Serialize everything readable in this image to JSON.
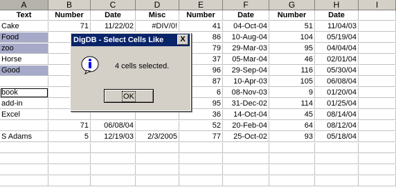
{
  "columns": [
    "A",
    "B",
    "C",
    "D",
    "E",
    "F",
    "G",
    "H",
    "I"
  ],
  "headers": [
    "Text",
    "Number",
    "Date",
    "Misc",
    "Number",
    "Date",
    "Number",
    "Date",
    ""
  ],
  "rows": [
    [
      "Cake",
      "71",
      "11/22/02",
      "#DIV/0!",
      "41",
      "04-Oct-04",
      "51",
      "11/04/03",
      ""
    ],
    [
      "Food",
      "",
      "",
      "",
      "86",
      "10-Aug-04",
      "104",
      "05/19/04",
      ""
    ],
    [
      "zoo",
      "",
      "",
      "",
      "79",
      "29-Mar-03",
      "95",
      "04/04/04",
      ""
    ],
    [
      "Horse",
      "",
      "",
      "",
      "37",
      "05-Mar-04",
      "46",
      "02/01/04",
      ""
    ],
    [
      "Good",
      "",
      "",
      "",
      "96",
      "29-Sep-04",
      "116",
      "05/30/04",
      ""
    ],
    [
      "",
      "",
      "",
      "",
      "87",
      "10-Apr-03",
      "105",
      "06/08/04",
      ""
    ],
    [
      "book",
      "",
      "",
      "",
      "6",
      "08-Nov-03",
      "9",
      "01/20/04",
      ""
    ],
    [
      "add-in",
      "",
      "",
      "",
      "95",
      "31-Dec-02",
      "114",
      "01/25/04",
      ""
    ],
    [
      "Excel",
      "",
      "",
      "",
      "36",
      "14-Oct-04",
      "45",
      "08/14/04",
      ""
    ],
    [
      "",
      "71",
      "06/08/04",
      "",
      "52",
      "20-Feb-04",
      "64",
      "08/12/04",
      ""
    ],
    [
      "S Adams",
      "5",
      "12/19/03",
      "2/3/2005",
      "77",
      "25-Oct-02",
      "93",
      "05/18/04",
      ""
    ],
    [
      "",
      "",
      "",
      "",
      "",
      "",
      "",
      "",
      ""
    ],
    [
      "",
      "",
      "",
      "",
      "",
      "",
      "",
      "",
      ""
    ],
    [
      "",
      "",
      "",
      "",
      "",
      "",
      "",
      "",
      ""
    ],
    [
      "",
      "",
      "",
      "",
      "",
      "",
      "",
      "",
      ""
    ]
  ],
  "highlighted_rows": [
    1,
    2,
    4
  ],
  "boxed_row": 6,
  "dialog": {
    "title": "DigDB - Select Cells Like",
    "close": "X",
    "message": "4 cells selected.",
    "ok": "OK",
    "icon": "info-icon"
  }
}
